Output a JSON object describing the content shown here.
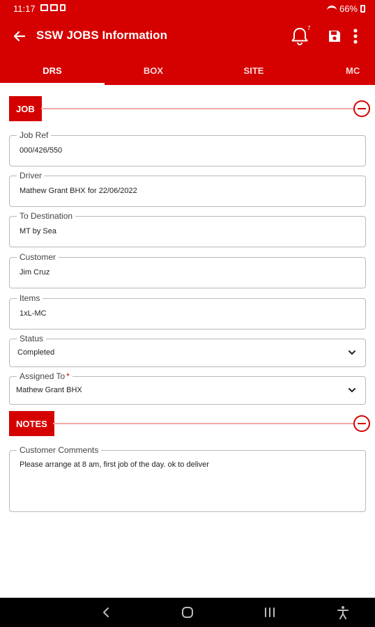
{
  "status_bar": {
    "time": "11:17",
    "battery": "66%"
  },
  "app_bar": {
    "title": "SSW JOBS Information",
    "notification_count": "7",
    "icons": [
      "back-arrow-icon",
      "bell-icon",
      "save-icon",
      "more-vert-icon"
    ]
  },
  "tabs": [
    {
      "label": "DRS",
      "active": true
    },
    {
      "label": "BOX",
      "active": false
    },
    {
      "label": "SITE",
      "active": false
    },
    {
      "label": "MC",
      "active": false
    }
  ],
  "sections": {
    "job": {
      "label": "JOB",
      "fields": {
        "job_ref": {
          "label": "Job Ref",
          "value": "000/426/550"
        },
        "driver": {
          "label": "Driver",
          "value": "Mathew Grant BHX for 22/06/2022"
        },
        "to_destination": {
          "label": "To Destination",
          "value": "MT by Sea"
        },
        "customer": {
          "label": "Customer",
          "value": "Jim Cruz"
        },
        "items": {
          "label": "Items",
          "value": "1xL-MC"
        },
        "status": {
          "label": "Status",
          "value": "Completed"
        },
        "assigned_to": {
          "label": "Assigned To",
          "required_mark": "*",
          "value": "Mathew Grant BHX"
        }
      }
    },
    "notes": {
      "label": "NOTES",
      "fields": {
        "customer_comments": {
          "label": "Customer Comments",
          "value": "Please arrange at 8 am, first job of the day. ok to deliver"
        }
      }
    }
  },
  "colors": {
    "brand_red": "#d50000",
    "divider_pink": "#f2a9a9",
    "nav_bar": "#000000"
  }
}
